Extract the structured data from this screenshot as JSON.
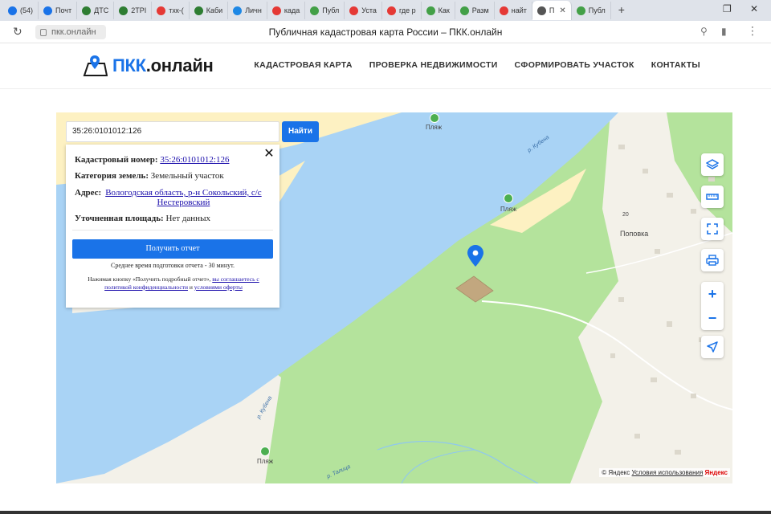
{
  "browser": {
    "tabs": [
      {
        "label": "(54)",
        "color": "#1a73e8"
      },
      {
        "label": "Почт",
        "color": "#1a73e8"
      },
      {
        "label": "ДТС",
        "color": "#2e7d32"
      },
      {
        "label": "2ТРI",
        "color": "#2e7d32"
      },
      {
        "label": "тхк-(",
        "color": "#e53935"
      },
      {
        "label": "Каби",
        "color": "#2e7d32"
      },
      {
        "label": "Личн",
        "color": "#1e88e5"
      },
      {
        "label": "када",
        "color": "#e53935"
      },
      {
        "label": "Публ",
        "color": "#43a047"
      },
      {
        "label": "Уста",
        "color": "#e53935"
      },
      {
        "label": "где р",
        "color": "#e53935"
      },
      {
        "label": "Как",
        "color": "#43a047"
      },
      {
        "label": "Разм",
        "color": "#43a047"
      },
      {
        "label": "найт",
        "color": "#e53935"
      },
      {
        "label": "П",
        "color": "#555555"
      },
      {
        "label": "Публ",
        "color": "#43a047"
      }
    ],
    "active_tab_index": 14,
    "new_tab": "+",
    "url": "пкк.онлайн",
    "page_title": "Публичная кадастровая карта России – ПКК.онлайн"
  },
  "site": {
    "logo_main": "ПКК",
    "logo_suffix": ".онлайн",
    "nav": [
      "КАДАСТРОВАЯ КАРТА",
      "ПРОВЕРКА НЕДВИЖИМОСТИ",
      "СФОРМИРОВАТЬ УЧАСТОК",
      "КОНТАКТЫ"
    ]
  },
  "search": {
    "value": "35:26:0101012:126",
    "button_label": "Найти"
  },
  "info_card": {
    "cadastral_label": "Кадастровый номер:",
    "cadastral_value": "35:26:0101012:126",
    "category_label": "Категория земель:",
    "category_value": "Земельный участок",
    "address_label": "Адрес:",
    "address_line1": "Вологодская область, р-н Сокольский, с/с",
    "address_line2": "Нестеровский",
    "area_label": "Уточненная площадь:",
    "area_value": "Нет данных",
    "report_button": "Получить отчет",
    "avg_time": "Среднее время подготовки отчета - 30 минут.",
    "disclaimer_prefix": "Нажимая кнопку «Получить подробный отчет»,",
    "disclaimer_link1": "вы соглашаетесь с политикой конфиденциальности",
    "disclaimer_and": "и",
    "disclaimer_link2": "условиями оферты"
  },
  "map": {
    "labels": {
      "beach": "Пляж",
      "village": "Поповка",
      "house_number": "20",
      "river_kubena": "р. Кубена",
      "river_talitsa": "р. Талица"
    },
    "copyright_prefix": "© Яндекс",
    "copyright_link": "Условия использования",
    "copyright_brand": "Яндекс",
    "colors": {
      "water": "#a9d3f5",
      "forest": "#b4e39c",
      "sand": "#fdf1c2",
      "settlement": "#f3f1e9",
      "parcel": "#c2a77f",
      "pin": "#1a73e8"
    }
  }
}
